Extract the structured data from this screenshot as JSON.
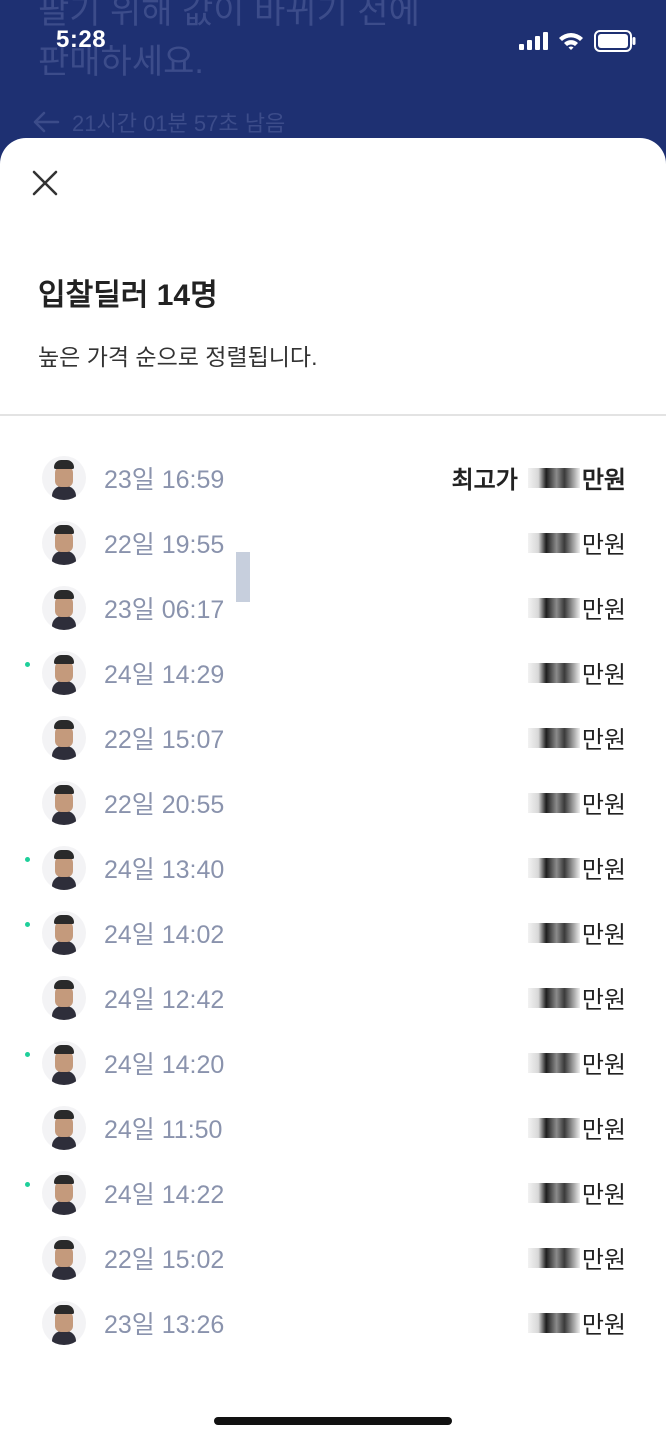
{
  "status_bar": {
    "time": "5:28"
  },
  "background": {
    "line1": "팔기 위해 값이 바뀌기 전에",
    "line2": "판매하세요.",
    "countdown": "21시간 01분 57초 남음"
  },
  "sheet": {
    "title": "입찰딜러 14명",
    "subtitle": "높은 가격 순으로 정렬됩니다.",
    "highest_label": "최고가"
  },
  "bids": [
    {
      "time": "23일 16:59",
      "unit": "만원",
      "top": true,
      "online": false
    },
    {
      "time": "22일 19:55",
      "unit": "만원",
      "top": false,
      "online": false
    },
    {
      "time": "23일 06:17",
      "unit": "만원",
      "top": false,
      "online": false
    },
    {
      "time": "24일 14:29",
      "unit": "만원",
      "top": false,
      "online": true
    },
    {
      "time": "22일 15:07",
      "unit": "만원",
      "top": false,
      "online": false
    },
    {
      "time": "22일 20:55",
      "unit": "만원",
      "top": false,
      "online": false
    },
    {
      "time": "24일 13:40",
      "unit": "만원",
      "top": false,
      "online": true
    },
    {
      "time": "24일 14:02",
      "unit": "만원",
      "top": false,
      "online": true
    },
    {
      "time": "24일 12:42",
      "unit": "만원",
      "top": false,
      "online": false
    },
    {
      "time": "24일 14:20",
      "unit": "만원",
      "top": false,
      "online": true
    },
    {
      "time": "24일 11:50",
      "unit": "만원",
      "top": false,
      "online": false
    },
    {
      "time": "24일 14:22",
      "unit": "만원",
      "top": false,
      "online": true
    },
    {
      "time": "22일 15:02",
      "unit": "만원",
      "top": false,
      "online": false
    },
    {
      "time": "23일 13:26",
      "unit": "만원",
      "top": false,
      "online": false
    }
  ],
  "colors": {
    "header_bg": "#1e3072",
    "time_text": "#8a93ad",
    "online_dot": "#1ecf9a"
  }
}
